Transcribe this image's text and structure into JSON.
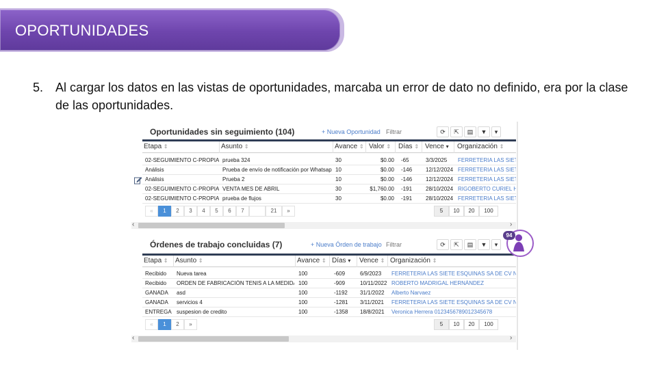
{
  "slide": {
    "title": "OPORTUNIDADES",
    "item_number": "5.",
    "item_text": "Al cargar los datos en las vistas de oportunidades, marcaba un error de dato no definido, era por la clase de las oportunidades."
  },
  "opportunities": {
    "title": "Oportunidades sin seguimiento (104)",
    "new_label": "+ Nueva Oportunidad",
    "filter_placeholder": "Filtrar",
    "columns": [
      "Etapa",
      "Asunto",
      "Avance",
      "Valor",
      "Días",
      "Vence",
      "Organización"
    ],
    "rows": [
      [
        "02-SEGUIMIENTO C-PROPIA",
        "prueba 324",
        "30",
        "$0.00",
        "-65",
        "3/3/2025",
        "FERRETERIA LAS SIET"
      ],
      [
        "Análisis",
        "Prueba de envío de notificación por Whatsapp",
        "10",
        "$0.00",
        "-146",
        "12/12/2024",
        "FERRETERIA LAS SIET"
      ],
      [
        "Análisis",
        "Prueba 2",
        "10",
        "$0.00",
        "-146",
        "12/12/2024",
        "FERRETERIA LAS SIET"
      ],
      [
        "02-SEGUIMIENTO C-PROPIA",
        "VENTA MES DE ABRIL",
        "30",
        "$1,760.00",
        "-191",
        "28/10/2024",
        "RIGOBERTO CURIEL H"
      ],
      [
        "02-SEGUIMIENTO C-PROPIA",
        "prueba de flujos",
        "30",
        "$0.00",
        "-191",
        "28/10/2024",
        "FERRETERIA LAS SIET"
      ]
    ],
    "pages": [
      "«",
      "1",
      "2",
      "3",
      "4",
      "5",
      "6",
      "7",
      "",
      "21",
      "»"
    ],
    "page_sizes": [
      "5",
      "10",
      "20",
      "100"
    ]
  },
  "orders": {
    "title": "Órdenes de trabajo concluidas (7)",
    "new_label": "+ Nueva Órden de trabajo",
    "filter_placeholder": "Filtrar",
    "columns": [
      "Etapa",
      "Asunto",
      "Avance",
      "Días",
      "Vence",
      "Organización"
    ],
    "rows": [
      [
        "Recibido",
        "Nueva tarea",
        "100",
        "-609",
        "6/9/2023",
        "FERRETERIA LAS SIETE ESQUINAS SA DE CV NC"
      ],
      [
        "Recibido",
        "ORDEN DE FABRICACIÓN TENIS A LA MEDIDA",
        "100",
        "-909",
        "10/11/2022",
        "ROBERTO MADRIGAL HERNÁNDEZ"
      ],
      [
        "GANADA",
        "asd",
        "100",
        "-1192",
        "31/1/2022",
        "Alberto Narvaez"
      ],
      [
        "GANADA",
        "servicios 4",
        "100",
        "-1281",
        "3/11/2021",
        "FERRETERIA LAS SIETE ESQUINAS SA DE CV NC"
      ],
      [
        "ENTREGA",
        "suspesion de credito",
        "100",
        "-1358",
        "18/8/2021",
        "Veronica Herrera 0123456789012345678"
      ]
    ],
    "pages": [
      "«",
      "1",
      "2",
      "»"
    ],
    "page_sizes": [
      "5",
      "10",
      "20",
      "100"
    ]
  },
  "badge": {
    "count": "94"
  },
  "colors": {
    "accent": "#6e45ad",
    "link": "#4a7cc9",
    "active_page": "#4a90d9",
    "header_bar": "#2f3d55"
  }
}
